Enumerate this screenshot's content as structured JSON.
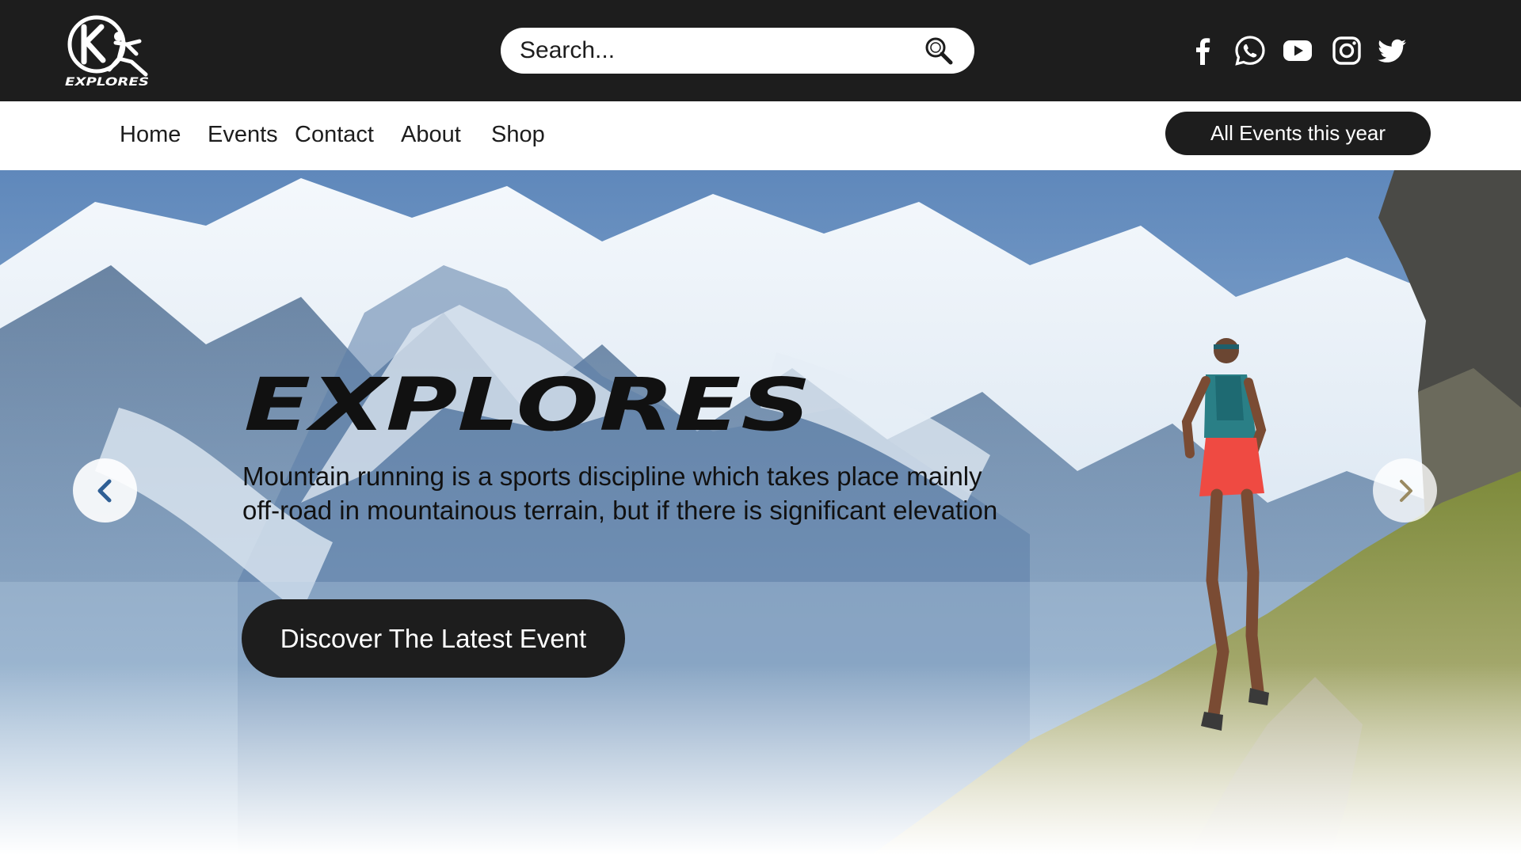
{
  "header": {
    "logo": {
      "text": "EXPLORES",
      "icon": "runner-logo-icon"
    },
    "search": {
      "placeholder": "Search...",
      "icon": "search-icon"
    },
    "social": [
      {
        "name": "facebook",
        "icon": "facebook-icon"
      },
      {
        "name": "whatsapp",
        "icon": "whatsapp-icon"
      },
      {
        "name": "youtube",
        "icon": "youtube-icon"
      },
      {
        "name": "instagram",
        "icon": "instagram-icon"
      },
      {
        "name": "twitter",
        "icon": "twitter-icon"
      }
    ]
  },
  "nav": {
    "items": [
      {
        "label": "Home"
      },
      {
        "label": "Events"
      },
      {
        "label": "Contact"
      },
      {
        "label": "About"
      },
      {
        "label": "Shop"
      }
    ],
    "cta_label": "All Events this year"
  },
  "hero": {
    "title": "EXPLORES",
    "description": "Mountain running is a sports discipline which takes place mainly off-road in mountainous terrain, but if there is significant elevation",
    "button_label": "Discover The Latest Event",
    "prev_icon": "chevron-left-icon",
    "next_icon": "chevron-right-icon"
  },
  "colors": {
    "header_bg": "#1d1d1d",
    "button_bg": "#1d1d1d",
    "nav_bg": "#ffffff",
    "text_dark": "#111111",
    "arrow_blue": "#2f5f95"
  }
}
